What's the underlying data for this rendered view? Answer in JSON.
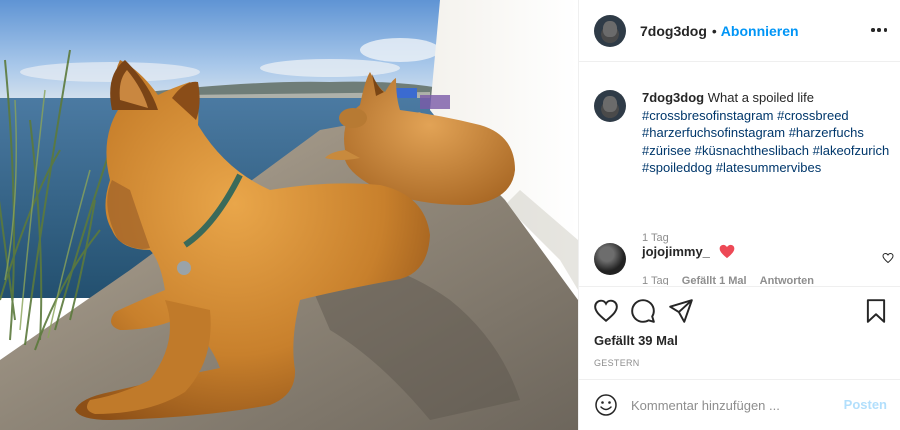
{
  "header": {
    "username": "7dog3dog",
    "separator": "•",
    "follow_label": "Abonnieren",
    "more_icon": "more-horizontal-icon"
  },
  "caption": {
    "username": "7dog3dog",
    "text": "What a spoiled life",
    "hashtags": [
      "#crossbresofinstagram",
      "#crossbreed",
      "#harzerfuchsofinstagram",
      "#harzerfuchs",
      "#zürisee",
      "#küsnachtheslibach",
      "#lakeofzurich",
      "#spoileddog",
      "#latesummervibes"
    ],
    "time": "1 Tag"
  },
  "reply": {
    "username": "jojojimmy_",
    "emoji": "heart-emoji",
    "time": "1 Tag",
    "likes": "Gefällt 1 Mal",
    "reply_label": "Antworten"
  },
  "actions": {
    "like_icon": "heart-outline-icon",
    "comment_icon": "comment-icon",
    "share_icon": "paper-plane-icon",
    "save_icon": "bookmark-icon"
  },
  "likes_text": "Gefällt 39 Mal",
  "date_text": "GESTERN",
  "comment_box": {
    "placeholder": "Kommentar hinzufügen ...",
    "post_label": "Posten"
  },
  "colors": {
    "accent": "#0095f6",
    "hashtag": "#00376b",
    "muted": "#8e8e8e",
    "post_disabled": "#b2dffc",
    "heart": "#ed4956"
  }
}
